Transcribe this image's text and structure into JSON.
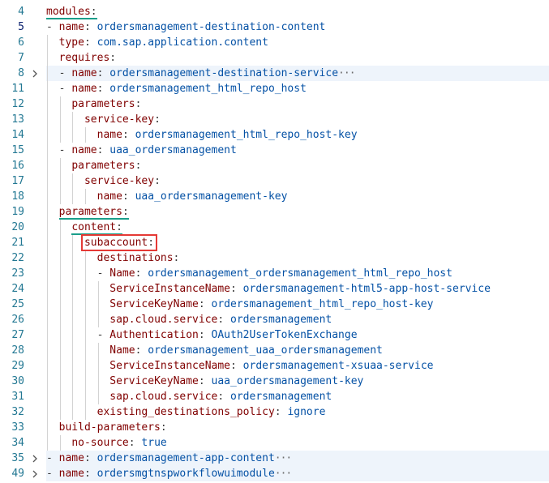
{
  "editor": {
    "lines": [
      {
        "num": "4",
        "indent": 0,
        "dash": false,
        "key": "modules",
        "colon": ":",
        "value": "",
        "fold": false,
        "hl": false,
        "cur": false
      },
      {
        "num": "5",
        "indent": 0,
        "dash": true,
        "key": "name",
        "colon": ": ",
        "value": "ordersmanagement-destination-content",
        "fold": false,
        "hl": false,
        "cur": true
      },
      {
        "num": "6",
        "indent": 1,
        "dash": false,
        "key": "type",
        "colon": ": ",
        "value": "com.sap.application.content",
        "fold": false,
        "hl": false,
        "cur": false
      },
      {
        "num": "7",
        "indent": 1,
        "dash": false,
        "key": "requires",
        "colon": ":",
        "value": "",
        "fold": false,
        "hl": false,
        "cur": false
      },
      {
        "num": "8",
        "indent": 1,
        "dash": true,
        "key": "name",
        "colon": ": ",
        "value": "ordersmanagement-destination-service",
        "fold": true,
        "hl": true,
        "cur": false
      },
      {
        "num": "11",
        "indent": 1,
        "dash": true,
        "key": "name",
        "colon": ": ",
        "value": "ordersmanagement_html_repo_host",
        "fold": false,
        "hl": false,
        "cur": false
      },
      {
        "num": "12",
        "indent": 2,
        "dash": false,
        "key": "parameters",
        "colon": ":",
        "value": "",
        "fold": false,
        "hl": false,
        "cur": false
      },
      {
        "num": "13",
        "indent": 3,
        "dash": false,
        "key": "service-key",
        "colon": ":",
        "value": "",
        "fold": false,
        "hl": false,
        "cur": false
      },
      {
        "num": "14",
        "indent": 4,
        "dash": false,
        "key": "name",
        "colon": ": ",
        "value": "ordersmanagement_html_repo_host-key",
        "fold": false,
        "hl": false,
        "cur": false
      },
      {
        "num": "15",
        "indent": 1,
        "dash": true,
        "key": "name",
        "colon": ": ",
        "value": "uaa_ordersmanagement",
        "fold": false,
        "hl": false,
        "cur": false
      },
      {
        "num": "16",
        "indent": 2,
        "dash": false,
        "key": "parameters",
        "colon": ":",
        "value": "",
        "fold": false,
        "hl": false,
        "cur": false
      },
      {
        "num": "17",
        "indent": 3,
        "dash": false,
        "key": "service-key",
        "colon": ":",
        "value": "",
        "fold": false,
        "hl": false,
        "cur": false
      },
      {
        "num": "18",
        "indent": 4,
        "dash": false,
        "key": "name",
        "colon": ": ",
        "value": "uaa_ordersmanagement-key",
        "fold": false,
        "hl": false,
        "cur": false
      },
      {
        "num": "19",
        "indent": 1,
        "dash": false,
        "key": "parameters",
        "colon": ":",
        "value": "",
        "fold": false,
        "hl": false,
        "cur": false
      },
      {
        "num": "20",
        "indent": 2,
        "dash": false,
        "key": "content",
        "colon": ":",
        "value": "",
        "fold": false,
        "hl": false,
        "cur": false
      },
      {
        "num": "21",
        "indent": 3,
        "dash": false,
        "key": "subaccount",
        "colon": ":",
        "value": "",
        "fold": false,
        "hl": false,
        "cur": false
      },
      {
        "num": "22",
        "indent": 4,
        "dash": false,
        "key": "destinations",
        "colon": ":",
        "value": "",
        "fold": false,
        "hl": false,
        "cur": false
      },
      {
        "num": "23",
        "indent": 4,
        "dash": true,
        "key": "Name",
        "colon": ": ",
        "value": "ordersmanagement_ordersmanagement_html_repo_host",
        "fold": false,
        "hl": false,
        "cur": false
      },
      {
        "num": "24",
        "indent": 5,
        "dash": false,
        "key": "ServiceInstanceName",
        "colon": ": ",
        "value": "ordersmanagement-html5-app-host-service",
        "fold": false,
        "hl": false,
        "cur": false
      },
      {
        "num": "25",
        "indent": 5,
        "dash": false,
        "key": "ServiceKeyName",
        "colon": ": ",
        "value": "ordersmanagement_html_repo_host-key",
        "fold": false,
        "hl": false,
        "cur": false
      },
      {
        "num": "26",
        "indent": 5,
        "dash": false,
        "key": "sap.cloud.service",
        "colon": ": ",
        "value": "ordersmanagement",
        "fold": false,
        "hl": false,
        "cur": false
      },
      {
        "num": "27",
        "indent": 4,
        "dash": true,
        "key": "Authentication",
        "colon": ": ",
        "value": "OAuth2UserTokenExchange",
        "fold": false,
        "hl": false,
        "cur": false
      },
      {
        "num": "28",
        "indent": 5,
        "dash": false,
        "key": "Name",
        "colon": ": ",
        "value": "ordersmanagement_uaa_ordersmanagement",
        "fold": false,
        "hl": false,
        "cur": false
      },
      {
        "num": "29",
        "indent": 5,
        "dash": false,
        "key": "ServiceInstanceName",
        "colon": ": ",
        "value": "ordersmanagement-xsuaa-service",
        "fold": false,
        "hl": false,
        "cur": false
      },
      {
        "num": "30",
        "indent": 5,
        "dash": false,
        "key": "ServiceKeyName",
        "colon": ": ",
        "value": "uaa_ordersmanagement-key",
        "fold": false,
        "hl": false,
        "cur": false
      },
      {
        "num": "31",
        "indent": 5,
        "dash": false,
        "key": "sap.cloud.service",
        "colon": ": ",
        "value": "ordersmanagement",
        "fold": false,
        "hl": false,
        "cur": false
      },
      {
        "num": "32",
        "indent": 4,
        "dash": false,
        "key": "existing_destinations_policy",
        "colon": ": ",
        "value": "ignore",
        "fold": false,
        "hl": false,
        "cur": false
      },
      {
        "num": "33",
        "indent": 1,
        "dash": false,
        "key": "build-parameters",
        "colon": ":",
        "value": "",
        "fold": false,
        "hl": false,
        "cur": false
      },
      {
        "num": "34",
        "indent": 2,
        "dash": false,
        "key": "no-source",
        "colon": ": ",
        "value": "true",
        "fold": false,
        "hl": false,
        "cur": false
      },
      {
        "num": "35",
        "indent": 0,
        "dash": true,
        "key": "name",
        "colon": ": ",
        "value": "ordersmanagement-app-content",
        "fold": true,
        "hl": true,
        "cur": false
      },
      {
        "num": "49",
        "indent": 0,
        "dash": true,
        "key": "name",
        "colon": ": ",
        "value": "ordersmgtnspworkflowuimodule",
        "fold": true,
        "hl": true,
        "cur": false
      }
    ],
    "fold_ellipsis": "···",
    "colors": {
      "key": "#800000",
      "value": "#0451a5",
      "line_number": "#237893",
      "annotation_underline": "#1a9e8a",
      "annotation_box": "#e53935",
      "fold_highlight": "#eef4fb"
    }
  }
}
